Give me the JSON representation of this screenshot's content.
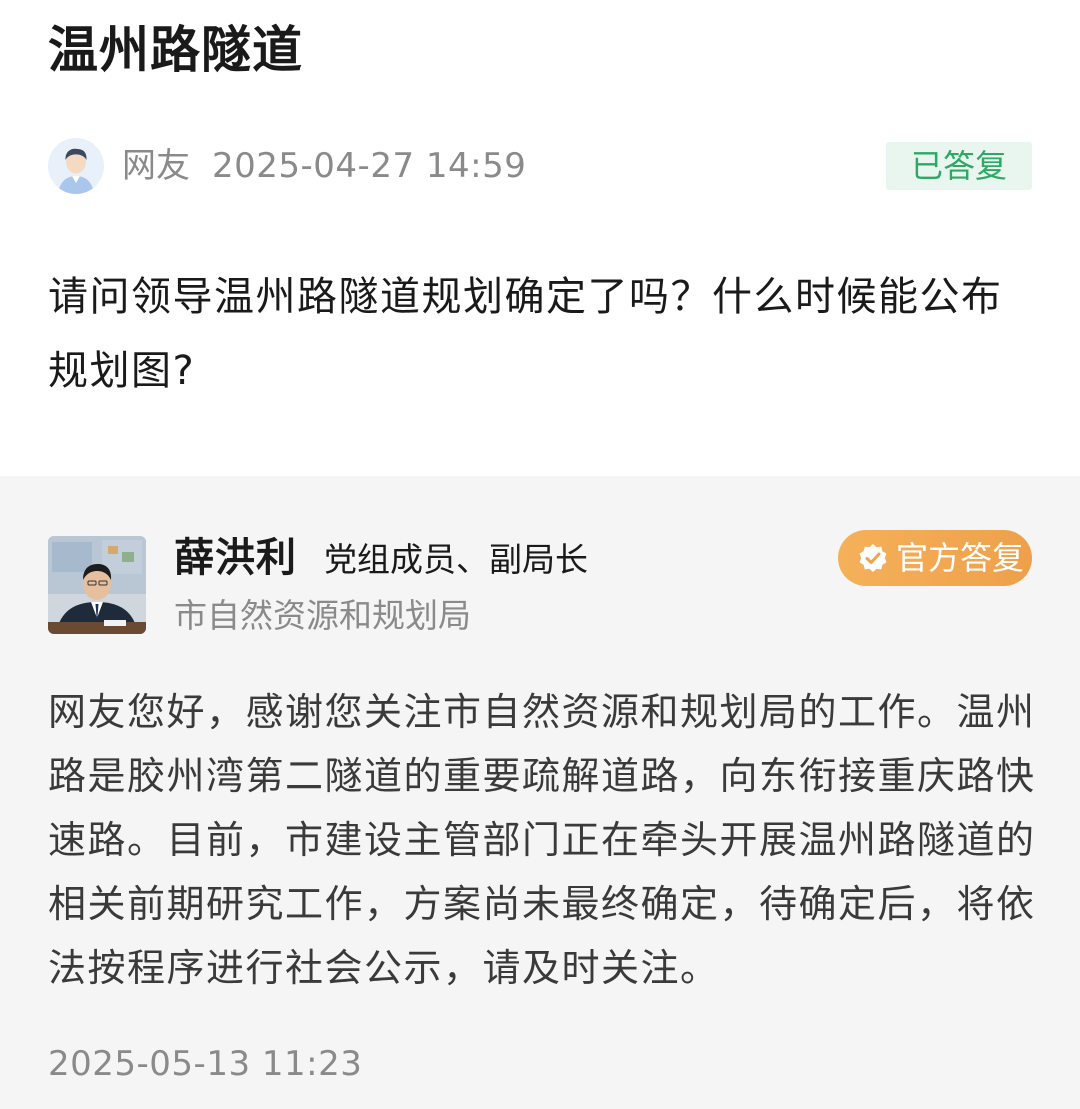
{
  "question": {
    "title": "温州路隧道",
    "asker_name": "网友",
    "asker_time": "2025-04-27 14:59",
    "status": "已答复",
    "status_color": "#2fa866",
    "text": "请问领导温州路隧道规划确定了吗？什么时候能公布规划图?",
    "avatar_icon": "user-avatar-icon"
  },
  "answer": {
    "responder_name": "薛洪利",
    "responder_title": "党组成员、副局长",
    "department": "市自然资源和规划局",
    "badge_label": "官方答复",
    "badge_icon": "verified-check-icon",
    "badge_color": "#f0a34c",
    "text": "网友您好，感谢您关注市自然资源和规划局的工作。温州路是胶州湾第二隧道的重要疏解道路，向东衔接重庆路快速路。目前，市建设主管部门正在牵头开展温州路隧道的相关前期研究工作，方案尚未最终确定，待确定后，将依法按程序进行社会公示，请及时关注。",
    "time": "2025-05-13 11:23"
  }
}
